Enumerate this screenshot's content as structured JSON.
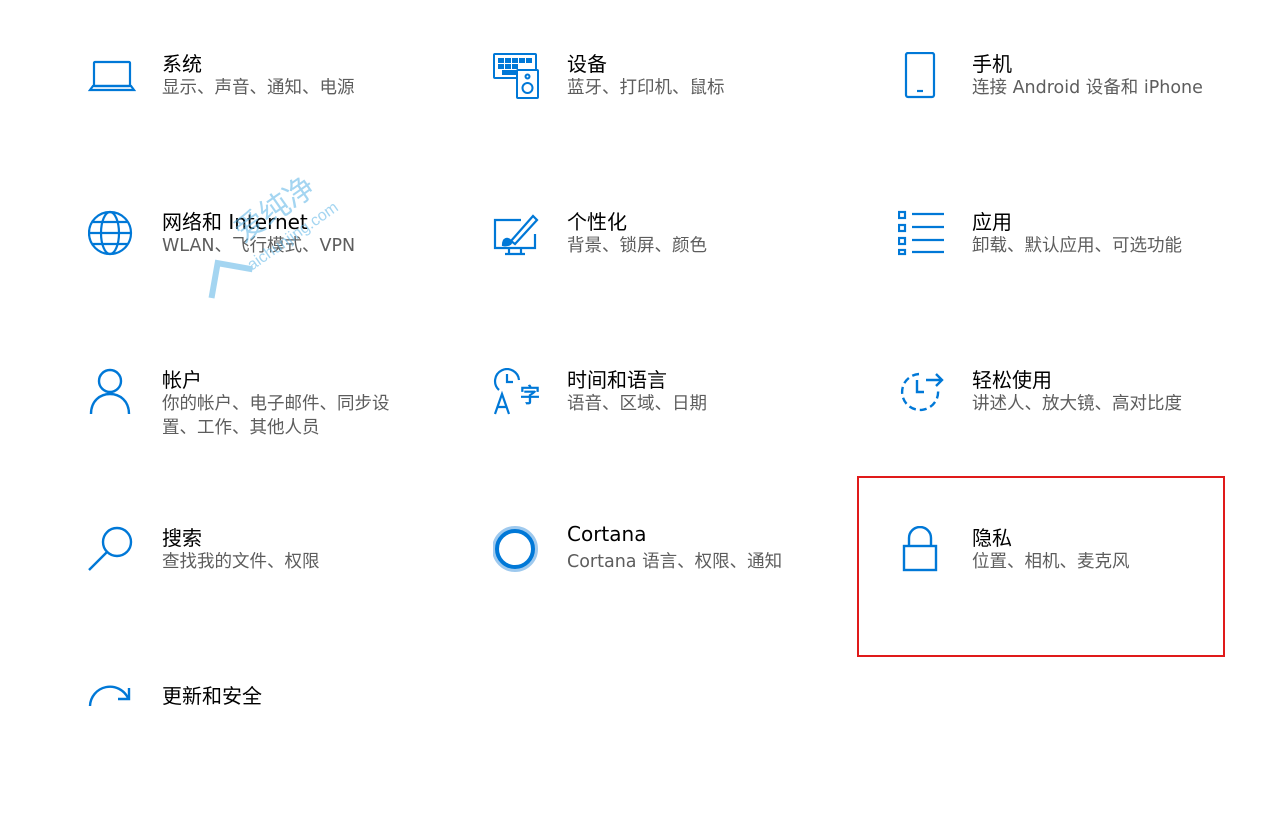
{
  "tiles": [
    {
      "title": "系统",
      "desc": "显示、声音、通知、电源",
      "icon": "laptop-icon"
    },
    {
      "title": "设备",
      "desc": "蓝牙、打印机、鼠标",
      "icon": "keyboard-speaker-icon"
    },
    {
      "title": "手机",
      "desc": "连接 Android 设备和 iPhone",
      "icon": "phone-icon"
    },
    {
      "title": "网络和 Internet",
      "desc": "WLAN、飞行模式、VPN",
      "icon": "globe-icon"
    },
    {
      "title": "个性化",
      "desc": "背景、锁屏、颜色",
      "icon": "paint-monitor-icon"
    },
    {
      "title": "应用",
      "desc": "卸载、默认应用、可选功能",
      "icon": "apps-list-icon"
    },
    {
      "title": "帐户",
      "desc": "你的帐户、电子邮件、同步设置、工作、其他人员",
      "icon": "person-icon"
    },
    {
      "title": "时间和语言",
      "desc": "语音、区域、日期",
      "icon": "time-language-icon"
    },
    {
      "title": "轻松使用",
      "desc": "讲述人、放大镜、高对比度",
      "icon": "ease-of-access-icon"
    },
    {
      "title": "搜索",
      "desc": "查找我的文件、权限",
      "icon": "search-icon"
    },
    {
      "title": "Cortana",
      "desc": "Cortana 语言、权限、通知",
      "icon": "cortana-icon"
    },
    {
      "title": "隐私",
      "desc": "位置、相机、麦克风",
      "icon": "lock-icon"
    },
    {
      "title": "更新和安全",
      "desc": "",
      "icon": "update-icon"
    }
  ],
  "watermark": {
    "text": "爱纯净",
    "sub": "aichunjing.com"
  },
  "colors": {
    "accent": "#0078d7",
    "highlight": "#e01a1a"
  }
}
